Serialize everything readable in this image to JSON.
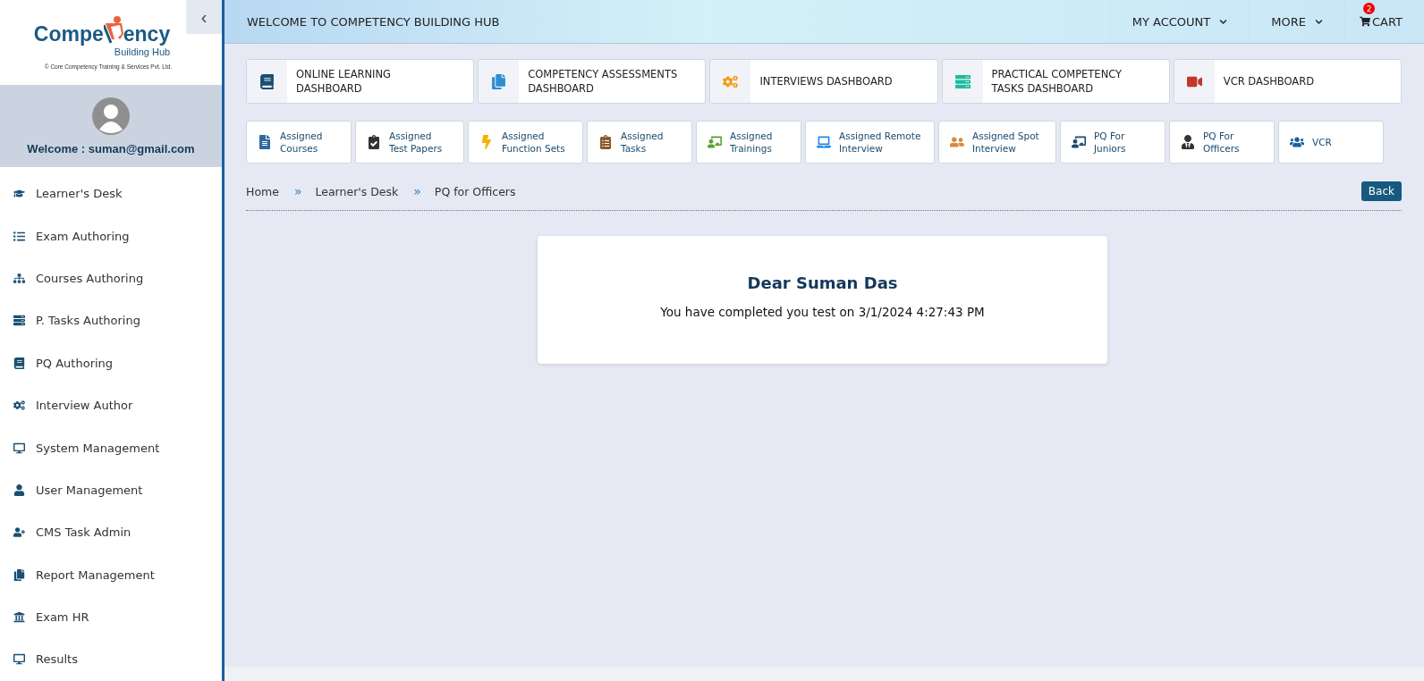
{
  "sidebar": {
    "collapse_button": "‹",
    "logo": {
      "title_start": "Compe",
      "title_end": "ency",
      "subtitle": "Building Hub",
      "copyright": "© Core Competency Training & Services Pvt. Ltd."
    },
    "welcome": "Welcome : suman@gmail.com",
    "items": [
      {
        "label": "Learner's Desk"
      },
      {
        "label": "Exam Authoring"
      },
      {
        "label": "Courses Authoring"
      },
      {
        "label": "P. Tasks Authoring"
      },
      {
        "label": "PQ Authoring"
      },
      {
        "label": "Interview Author"
      },
      {
        "label": "System Management"
      },
      {
        "label": "User Management"
      },
      {
        "label": "CMS Task Admin"
      },
      {
        "label": "Report Management"
      },
      {
        "label": "Exam HR"
      },
      {
        "label": "Results"
      }
    ]
  },
  "topbar": {
    "title": "WELCOME TO COMPETENCY BUILDING HUB",
    "menus": [
      "MY ACCOUNT",
      "MORE"
    ],
    "cart": {
      "label": "CART",
      "count": "2"
    }
  },
  "dashboards": [
    {
      "label": "ONLINE LEARNING DASHBOARD"
    },
    {
      "label": "COMPETENCY ASSESSMENTS DASHBOARD"
    },
    {
      "label": "INTERVIEWS DASHBOARD"
    },
    {
      "label": "PRACTICAL COMPETENCY TASKS DASHBOARD"
    },
    {
      "label": "VCR DASHBOARD"
    }
  ],
  "shortcuts": [
    {
      "label": "Assigned Courses"
    },
    {
      "label": "Assigned Test Papers"
    },
    {
      "label": "Assigned Function Sets"
    },
    {
      "label": "Assigned Tasks"
    },
    {
      "label": "Assigned Trainings"
    },
    {
      "label": "Assigned Remote Interview"
    },
    {
      "label": "Assigned Spot Interview"
    },
    {
      "label": "PQ For Juniors"
    },
    {
      "label": "PQ For Officers"
    },
    {
      "label": "VCR"
    }
  ],
  "breadcrumb": {
    "separator": "»",
    "items": [
      "Home",
      "Learner's Desk",
      "PQ for Officers"
    ]
  },
  "back_button": "Back",
  "message": {
    "title": "Dear Suman Das",
    "text": "You have completed you test on 3/1/2024 4:27:43 PM"
  }
}
